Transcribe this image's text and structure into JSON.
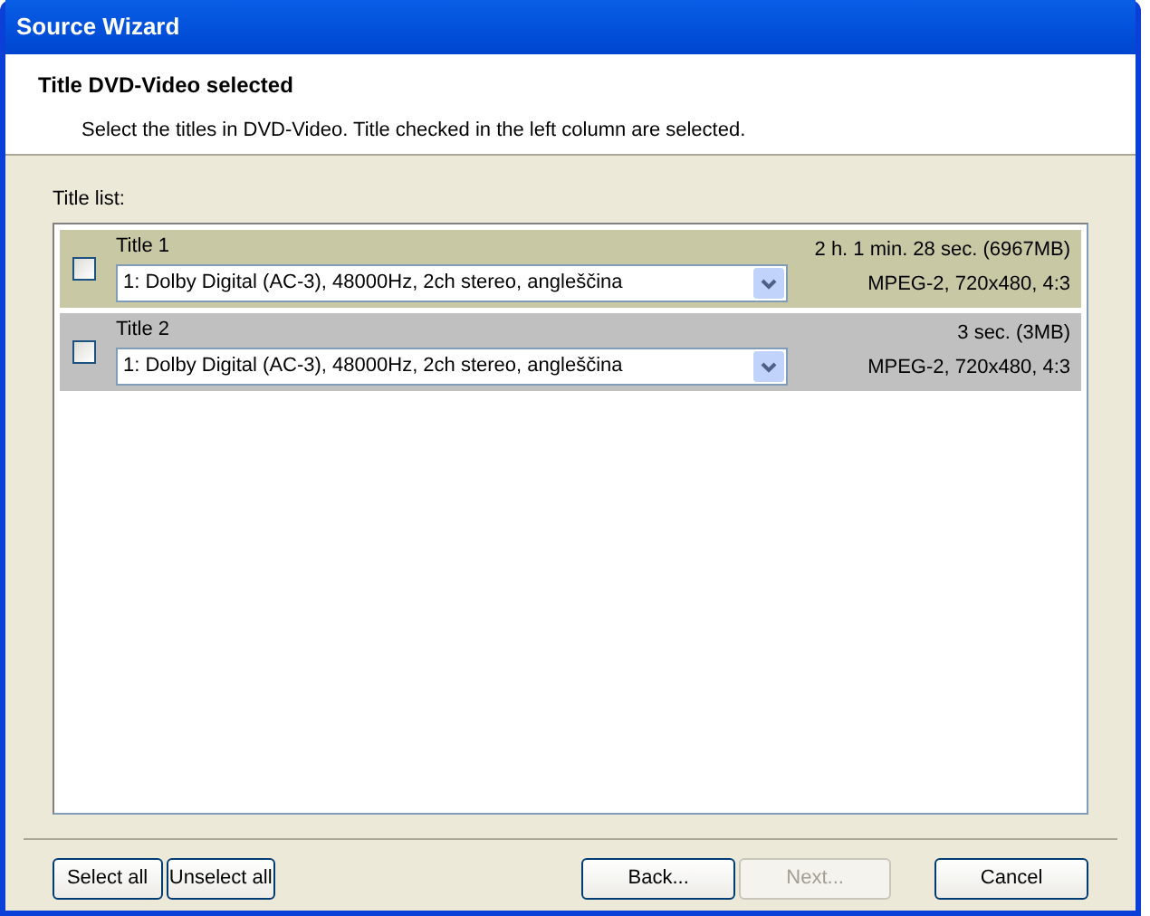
{
  "window": {
    "title": "Source Wizard"
  },
  "header": {
    "title": "Title DVD-Video selected",
    "description": "Select the titles in DVD-Video. Title checked in the left column are selected."
  },
  "title_list": {
    "label": "Title list:",
    "items": [
      {
        "name": "Title 1",
        "checked": false,
        "selected": true,
        "audio": "1: Dolby Digital (AC-3), 48000Hz, 2ch stereo, angleščina",
        "duration": "2 h. 1 min. 28 sec. (6967MB)",
        "format": "MPEG-2, 720x480, 4:3"
      },
      {
        "name": "Title 2",
        "checked": false,
        "selected": false,
        "audio": "1: Dolby Digital (AC-3), 48000Hz, 2ch stereo, angleščina",
        "duration": "3 sec. (3MB)",
        "format": "MPEG-2, 720x480, 4:3"
      }
    ]
  },
  "buttons": [
    {
      "label": "Select all",
      "disabled": false
    },
    {
      "label": "Unselect all",
      "disabled": false
    },
    {
      "label": "Back...",
      "disabled": false
    },
    {
      "label": "Next...",
      "disabled": true
    },
    {
      "label": "Cancel",
      "disabled": false
    }
  ]
}
